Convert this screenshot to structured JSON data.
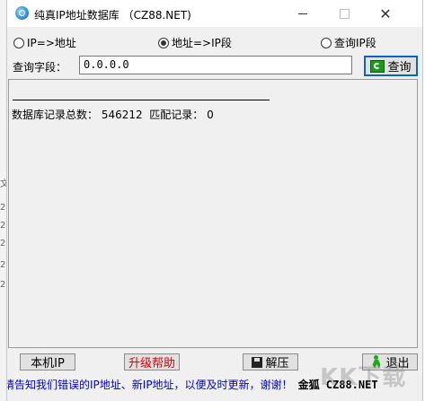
{
  "window": {
    "title": "纯真IP地址数据库 （CZ88.NET)",
    "minimize_glyph": "—",
    "maximize_glyph": "☐",
    "close_glyph": "✕"
  },
  "mode": {
    "options": [
      {
        "label": "IP=>地址",
        "selected": false
      },
      {
        "label": "地址=>IP段",
        "selected": true
      },
      {
        "label": "查询IP段",
        "selected": false
      }
    ]
  },
  "query": {
    "label": "查询字段：",
    "value": "0.0.0.0",
    "button_label": "查询"
  },
  "result": {
    "stats": "数据库记录总数： 546212  匹配记录： 0"
  },
  "buttons": {
    "local_ip": "本机IP",
    "upgrade_help": "升级帮助",
    "unzip": "解压",
    "exit": "退出"
  },
  "status": {
    "message": "请告知我们错误的IP地址、新IP地址，以便及时更新，谢谢！",
    "brand": "金狐 CZ88.NET"
  },
  "colors": {
    "accent": "#0a64c8",
    "upgrade_text": "#e00000",
    "status_text": "#0000cc"
  },
  "icons": {
    "app": "app-icon",
    "query": "refresh-icon",
    "unzip": "disk-icon",
    "exit": "exit-icon"
  },
  "watermark": "KK下载"
}
